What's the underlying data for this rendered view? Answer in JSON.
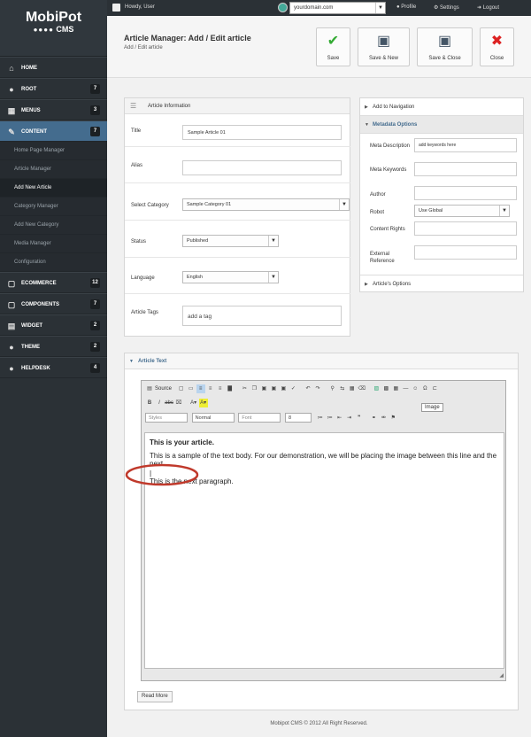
{
  "logo": {
    "line1": "MobiPot",
    "line2": "CMS",
    "dots": "●●●●"
  },
  "sidebar": {
    "items": [
      {
        "label": "HOME",
        "icon": "home-icon",
        "glyph": "⌂",
        "count": ""
      },
      {
        "label": "ROOT",
        "icon": "user-icon",
        "glyph": "●",
        "count": "7"
      },
      {
        "label": "MENUS",
        "icon": "grid-icon",
        "glyph": "▦",
        "count": "3"
      },
      {
        "label": "CONTENT",
        "icon": "pencil-icon",
        "glyph": "✎",
        "count": "7"
      },
      {
        "label": "ECOMMERCE",
        "icon": "edit-icon",
        "glyph": "▢",
        "count": "12"
      },
      {
        "label": "COMPONENTS",
        "icon": "edit-icon",
        "glyph": "▢",
        "count": "7"
      },
      {
        "label": "WIDGET",
        "icon": "code-icon",
        "glyph": "▤",
        "count": "2"
      },
      {
        "label": "THEME",
        "icon": "user-icon",
        "glyph": "●",
        "count": "2"
      },
      {
        "label": "HELPDESK",
        "icon": "user-icon",
        "glyph": "●",
        "count": "4"
      }
    ],
    "subitems": [
      "Home Page Manager",
      "Article Manager",
      "Add New Article",
      "Category Manager",
      "Add New Category",
      "Media Manager",
      "Configuration"
    ]
  },
  "topbar": {
    "greeting": "Howdy, User",
    "domain": "yourdomain.com",
    "profile": "Profile",
    "settings": "Settings",
    "logout": "Logout"
  },
  "header": {
    "title": "Article Manager: Add / Edit article",
    "crumb": "Add / Edit article"
  },
  "toolbar": {
    "save": "Save",
    "save_new": "Save & New",
    "save_close": "Save & Close",
    "close": "Close"
  },
  "article_info": {
    "heading": "Article Information",
    "title_label": "Title",
    "title_value": "Sample Article 01",
    "alias_label": "Alias",
    "alias_value": "",
    "category_label": "Select Category",
    "category_value": "Sample Category 01",
    "status_label": "Status",
    "status_value": "Published",
    "language_label": "Language",
    "language_value": "English",
    "tags_label": "Article Tags",
    "tags_placeholder": "add a tag"
  },
  "right_panel": {
    "nav": "Add to Navigation",
    "metadata": "Metadata Options",
    "meta_desc_label": "Meta Description",
    "meta_desc_placeholder": "add keywords here",
    "meta_keys_label": "Meta Keywords",
    "author_label": "Author",
    "robot_label": "Robot",
    "robot_value": "Use Global",
    "rights_label": "Content Rights",
    "extref_label": "External Reference",
    "options": "Article's Options"
  },
  "article_text": {
    "heading": "Article Text",
    "source": "Source",
    "styles": "Styles",
    "format": "Normal",
    "font": "Font",
    "size": "8",
    "tooltip": "Image",
    "body_heading": "This is your article.",
    "body_p1": "This is a sample of the text body. For our demonstration, we will be placing the image between this line and the next.",
    "body_p2": "This is the next paragraph.",
    "read_more": "Read More"
  },
  "footer": "Mobipot CMS © 2012 All Right Reserved."
}
